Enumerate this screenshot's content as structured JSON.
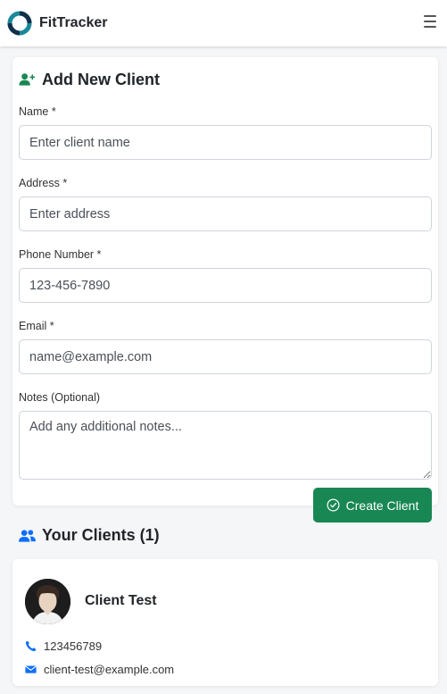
{
  "app": {
    "brand": "FitTracker"
  },
  "colors": {
    "primary": "#0d6efd",
    "success": "#198754",
    "logo_teal": "#1a8a9a",
    "logo_navy": "#12304a"
  },
  "form": {
    "title": "Add New Client",
    "fields": {
      "name": {
        "label": "Name *",
        "placeholder": "Enter client name"
      },
      "address": {
        "label": "Address *",
        "placeholder": "Enter address"
      },
      "phone": {
        "label": "Phone Number *",
        "placeholder": "123-456-7890"
      },
      "email": {
        "label": "Email *",
        "placeholder": "name@example.com"
      },
      "notes": {
        "label": "Notes (Optional)",
        "placeholder": "Add any additional notes..."
      }
    },
    "submit_label": "Create Client"
  },
  "clients": {
    "title": "Your Clients (1)",
    "items": [
      {
        "name": "Client Test",
        "phone": "123456789",
        "email": "client-test@example.com"
      }
    ]
  },
  "icons": {
    "menu": "hamburger-icon",
    "add_user": "user-plus-icon",
    "users": "users-icon",
    "check": "check-circle-icon",
    "phone": "phone-icon",
    "email": "envelope-icon"
  }
}
